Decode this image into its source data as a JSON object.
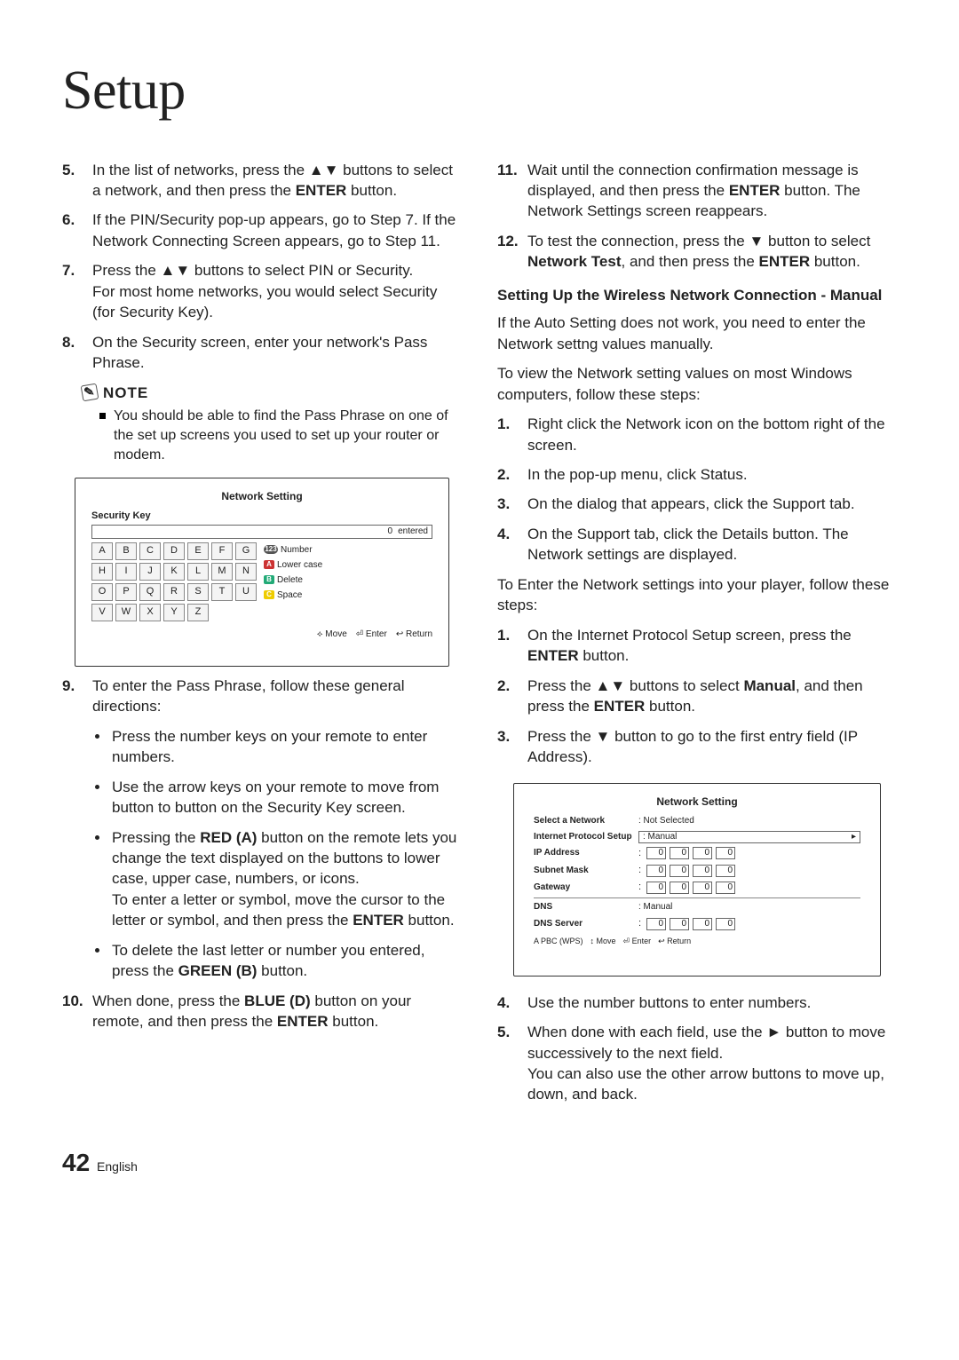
{
  "title": "Setup",
  "left": {
    "steps1": [
      {
        "n": 5,
        "html": "In the list of networks, press the ▲▼ buttons to select a network, and then press the <span class='b'>ENTER</span> button."
      },
      {
        "n": 6,
        "html": "If the PIN/Security pop-up appears, go to Step 7. If the Network Connecting Screen appears, go to Step 11."
      },
      {
        "n": 7,
        "html": "Press the ▲▼ buttons to select PIN or Security.<br>For most home networks, you would select Security (for Security Key)."
      },
      {
        "n": 8,
        "html": "On the Security screen, enter your network's Pass Phrase."
      }
    ],
    "note_label": "NOTE",
    "note_items": [
      "You should be able to find the Pass Phrase on one of the set up screens you used to set up your router or modem."
    ],
    "screenshot1": {
      "title": "Network Setting",
      "sub": "Security Key",
      "count": "0",
      "count_label": "entered",
      "keys": [
        "A",
        "B",
        "C",
        "D",
        "E",
        "F",
        "G",
        "H",
        "I",
        "J",
        "K",
        "L",
        "M",
        "N",
        "O",
        "P",
        "Q",
        "R",
        "S",
        "T",
        "U",
        "V",
        "W",
        "X",
        "Y",
        "Z"
      ],
      "legend": [
        {
          "badge": "bnum",
          "t": "123",
          "label": "Number"
        },
        {
          "badge": "ba",
          "t": "A",
          "label": "Lower case"
        },
        {
          "badge": "bb",
          "t": "B",
          "label": "Delete"
        },
        {
          "badge": "bc",
          "t": "C",
          "label": "Space"
        }
      ],
      "footer": [
        "⟡ Move",
        "⏎ Enter",
        "↩ Return"
      ]
    },
    "steps2": [
      {
        "n": 9,
        "html": "To enter the Pass Phrase, follow these general directions:"
      }
    ],
    "bullets": [
      "Press the number keys on your remote to enter numbers.",
      "Use the arrow keys on your remote to move from button to button on the Security Key screen.",
      "Pressing the <span class='b'>RED (A)</span> button on the remote lets you change the text displayed on the buttons to lower case, upper case, numbers, or icons.<br>To enter a letter or symbol, move the cursor to the letter or symbol, and then press the <span class='b'>ENTER</span> button.",
      "To delete the last letter or number you entered, press the <span class='b'>GREEN (B)</span> button."
    ],
    "steps3": [
      {
        "n": 10,
        "html": "When done, press the <span class='b'>BLUE (D)</span> button on your remote, and then press the <span class='b'>ENTER</span> button."
      }
    ]
  },
  "right": {
    "steps1": [
      {
        "n": 11,
        "html": "Wait until the connection confirmation message is displayed, and then press the <span class='b'>ENTER</span> button. The Network Settings screen reappears."
      },
      {
        "n": 12,
        "html": "To test the connection, press the ▼ button to select <span class='b'>Network Test</span>, and then press the <span class='b'>ENTER</span> button."
      }
    ],
    "subhead": "Setting Up the Wireless Network Connection - Manual",
    "p1": "If the Auto Setting does not work, you need to enter the Network settng values manually.",
    "p2": "To view the Network setting values on most Windows computers, follow these steps:",
    "steps2": [
      {
        "n": 1,
        "html": "Right click the Network icon on the bottom right of the screen."
      },
      {
        "n": 2,
        "html": "In the pop-up menu, click Status."
      },
      {
        "n": 3,
        "html": "On the dialog that appears, click the Support tab."
      },
      {
        "n": 4,
        "html": "On the Support tab, click the Details button. The Network settings are displayed."
      }
    ],
    "p3": "To Enter the Network settings into your player, follow these steps:",
    "steps3": [
      {
        "n": 1,
        "html": "On the Internet Protocol Setup screen, press the <span class='b'>ENTER</span> button."
      },
      {
        "n": 2,
        "html": "Press the ▲▼ buttons to select <span class='b'>Manual</span>, and then press the <span class='b'>ENTER</span> button."
      },
      {
        "n": 3,
        "html": "Press the ▼ button to go to the first entry field (IP Address)."
      }
    ],
    "screenshot2": {
      "title": "Network Setting",
      "rows": [
        {
          "label": "Select a Network",
          "type": "text",
          "val": ": Not Selected"
        },
        {
          "label": "Internet Protocol Setup",
          "type": "dd",
          "val": ": Manual"
        },
        {
          "label": "IP Address",
          "type": "ip"
        },
        {
          "label": "Subnet Mask",
          "type": "ip"
        },
        {
          "label": "Gateway",
          "type": "ip"
        },
        {
          "label": "DNS",
          "type": "sep"
        },
        {
          "label": "DNS",
          "type": "text",
          "val": ": Manual"
        },
        {
          "label": "DNS Server",
          "type": "ip"
        }
      ],
      "footer": [
        "A PBC (WPS)",
        "↕ Move",
        "⏎ Enter",
        "↩ Return"
      ]
    },
    "steps4": [
      {
        "n": 4,
        "html": "Use the number buttons to enter numbers."
      },
      {
        "n": 5,
        "html": "When done with each field, use the ► button to move successively to the next field.<br>You can also use the other arrow buttons to move up, down, and back."
      }
    ]
  },
  "footer": {
    "num": "42",
    "lang": "English"
  }
}
